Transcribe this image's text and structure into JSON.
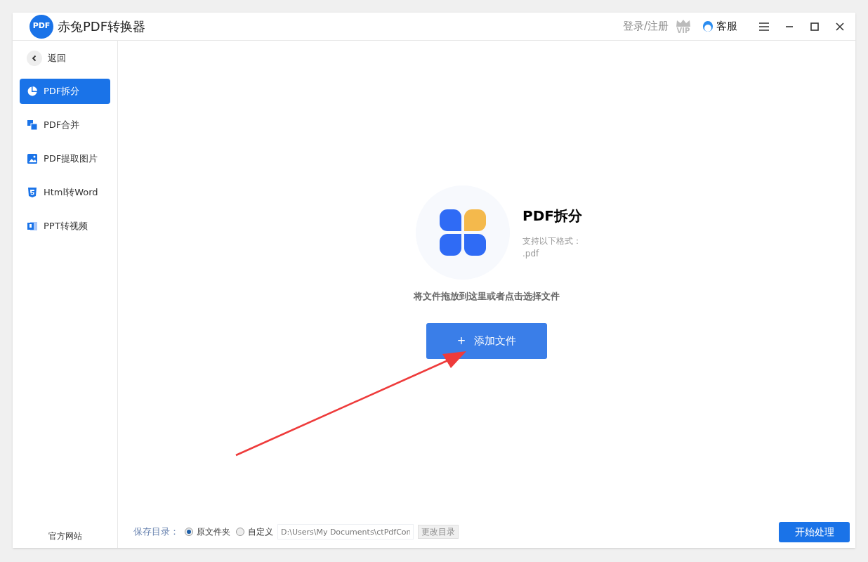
{
  "window": {
    "title": "赤兔PDF转换器",
    "logo": "PDF"
  },
  "header": {
    "login": "登录/注册",
    "vip": "VIP",
    "service": "客服"
  },
  "sidebar": {
    "back": "返回",
    "items": [
      {
        "label": "PDF拆分",
        "kind": "split",
        "selected": true
      },
      {
        "label": "PDF合并",
        "kind": "merge",
        "selected": false
      },
      {
        "label": "PDF提取图片",
        "kind": "image",
        "selected": false
      },
      {
        "label": "Html转Word",
        "kind": "html",
        "selected": false
      },
      {
        "label": "PPT转视频",
        "kind": "ppt",
        "selected": false
      }
    ],
    "footer": "官方网站"
  },
  "drop_zone": {
    "title": "PDF拆分",
    "formats_label": "支持以下格式：",
    "formats": ".pdf",
    "hint": "将文件拖放到这里或者点击选择文件",
    "add_button": {
      "icon": "+",
      "label": "添加文件"
    }
  },
  "save": {
    "label": "保存目录：",
    "options": [
      {
        "label": "原文件夹",
        "selected": true
      },
      {
        "label": "自定义",
        "selected": false
      }
    ],
    "path": "D:\\Users\\My Documents\\ctPdfCon",
    "change_button": "更改目录"
  },
  "start_button": "开始处理"
}
